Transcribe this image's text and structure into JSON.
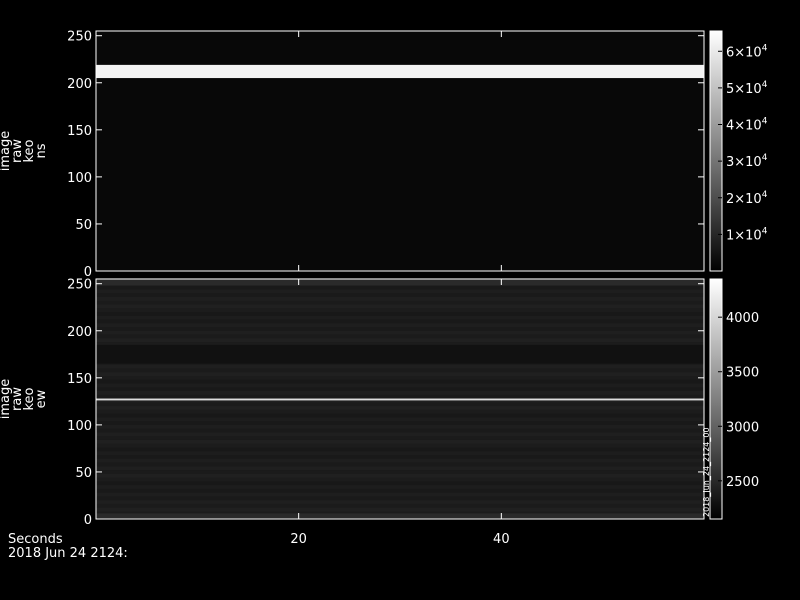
{
  "footer": {
    "xaxis_label": "Seconds",
    "date_label": "2018 Jun 24 2124:"
  },
  "chart_data": [
    {
      "type": "heatmap",
      "ylabel": [
        "image",
        "raw",
        "keo",
        "ns"
      ],
      "xlim": [
        0,
        60
      ],
      "xticks": [
        20,
        40
      ],
      "xtick_labels": [
        "",
        ""
      ],
      "ylim": [
        0,
        255
      ],
      "yticks": [
        0,
        50,
        100,
        150,
        200,
        250
      ],
      "ytick_labels": [
        "0",
        "50",
        "100",
        "150",
        "200",
        "250"
      ],
      "colorbar": {
        "scale": "linear",
        "range": [
          0,
          65535
        ],
        "ticks": [
          10000,
          20000,
          30000,
          40000,
          50000,
          60000
        ],
        "tick_labels": [
          {
            "mantissa": "1×10",
            "exp": "4"
          },
          {
            "mantissa": "2×10",
            "exp": "4"
          },
          {
            "mantissa": "3×10",
            "exp": "4"
          },
          {
            "mantissa": "4×10",
            "exp": "4"
          },
          {
            "mantissa": "5×10",
            "exp": "4"
          },
          {
            "mantissa": "6×10",
            "exp": "4"
          }
        ]
      },
      "features": [
        {
          "kind": "bright-band",
          "y_from": 205,
          "y_to": 219,
          "level": 65000,
          "color": "#f4f4f4"
        }
      ],
      "background_color": "#080808",
      "grid": false
    },
    {
      "type": "heatmap",
      "ylabel": [
        "image",
        "raw",
        "keo",
        "ew"
      ],
      "xlim": [
        0,
        60
      ],
      "xticks": [
        20,
        40
      ],
      "xtick_labels": [
        "20",
        "40"
      ],
      "ylim": [
        0,
        255
      ],
      "yticks": [
        0,
        50,
        100,
        150,
        200,
        250
      ],
      "ytick_labels": [
        "0",
        "50",
        "100",
        "150",
        "200",
        "250"
      ],
      "colorbar": {
        "scale": "linear",
        "range": [
          2150,
          4350
        ],
        "ticks": [
          2500,
          3000,
          3500,
          4000
        ],
        "tick_labels": [
          {
            "mantissa": "2500",
            "exp": ""
          },
          {
            "mantissa": "3000",
            "exp": ""
          },
          {
            "mantissa": "3500",
            "exp": ""
          },
          {
            "mantissa": "4000",
            "exp": ""
          }
        ]
      },
      "features": [
        {
          "kind": "bright-line",
          "y_from": 126,
          "y_to": 128,
          "level": 4300,
          "color": "#dcdcdc"
        },
        {
          "kind": "band",
          "y_from": 0,
          "y_to": 6,
          "level": 2450,
          "color": "#2a2a2a"
        },
        {
          "kind": "band",
          "y_from": 248,
          "y_to": 255,
          "level": 2450,
          "color": "#2a2a2a"
        },
        {
          "kind": "band",
          "y_from": 165,
          "y_to": 185,
          "level": 2250,
          "color": "#111111"
        }
      ],
      "background_color": "#1c1c1c",
      "vertical_note": "2018_Jun_24_2124_00",
      "grid": false
    }
  ],
  "colors": {
    "frame": "#ffffff",
    "background": "#000000"
  }
}
